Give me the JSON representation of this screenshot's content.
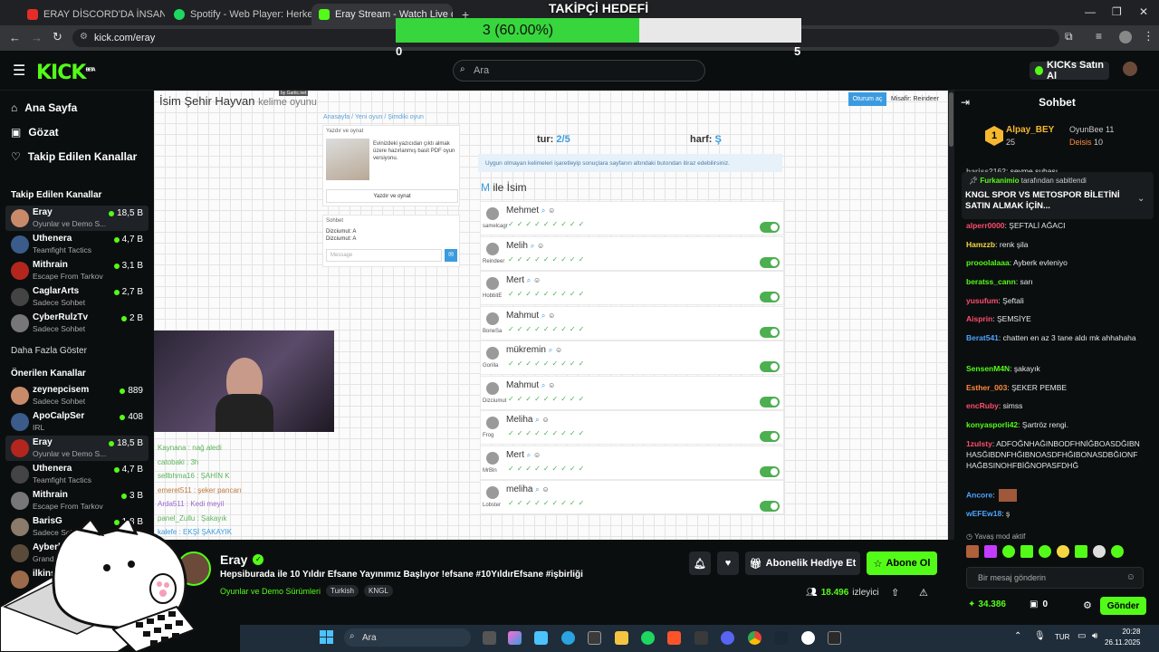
{
  "browser": {
    "tabs": [
      {
        "label": "ERAY DİSCORD'DA İNSANLARI..."
      },
      {
        "label": "Spotify - Web Player: Herkes için..."
      },
      {
        "label": "Eray Stream - Watch Live on Kick"
      }
    ],
    "new_tab": "+",
    "url": "kick.com/eray"
  },
  "goal": {
    "title": "TAKİPÇİ HEDEFİ",
    "text": "3 (60.00%)",
    "progress": 0.6,
    "min": "0",
    "max": "5"
  },
  "kick": {
    "logo": "KICK",
    "beta": "BETA",
    "search_placeholder": "Ara",
    "kicks_button": "KICKs Satın Al",
    "accent": "#53fc18"
  },
  "sidebar": {
    "nav": [
      "Ana Sayfa",
      "Gözat",
      "Takip Edilen Kanallar"
    ],
    "followed_title": "Takip Edilen Kanallar",
    "followed": [
      {
        "name": "Eray",
        "game": "Oyunlar ve Demo S...",
        "viewers": "18,5 B"
      },
      {
        "name": "Uthenera",
        "game": "Teamfight Tactics",
        "viewers": "4,7 B"
      },
      {
        "name": "Mithrain",
        "game": "Escape From Tarkov",
        "viewers": "3,1 B"
      },
      {
        "name": "CaglarArts",
        "game": "Sadece Sohbet",
        "viewers": "2,7 B"
      },
      {
        "name": "CyberRulzTv",
        "game": "Sadece Sohbet",
        "viewers": "2 B"
      }
    ],
    "show_more": "Daha Fazla Göster",
    "recommended_title": "Önerilen Kanallar",
    "recommended": [
      {
        "name": "zeynepcisem",
        "game": "Sadece Sohbet",
        "viewers": "889"
      },
      {
        "name": "ApoCalpSer",
        "game": "IRL",
        "viewers": "408"
      },
      {
        "name": "Eray",
        "game": "Oyunlar ve Demo S...",
        "viewers": "18,5 B"
      },
      {
        "name": "Uthenera",
        "game": "Teamfight Tactics",
        "viewers": "4,7 B"
      },
      {
        "name": "Mithrain",
        "game": "Escape From Tarkov",
        "viewers": "3 B"
      },
      {
        "name": "BarisG",
        "game": "Sadece Sohbet",
        "viewers": "1,8 B"
      },
      {
        "name": "Ayberk",
        "game": "Grand T...",
        "viewers": ""
      },
      {
        "name": "ilkins",
        "game": "",
        "viewers": ""
      }
    ]
  },
  "game": {
    "title": "İsim Şehir Hayvan",
    "subtitle": "kelime oyunu",
    "by": "by Gartic.net",
    "breadcrumb": "Anasayfa  /  Yeni oyun  /  Şimdiki oyun",
    "room_btn": "Oturum aç",
    "guest": "Misafir: Reindeer",
    "print_title": "Yazdır ve oynat",
    "print_desc": "Evinizdeki yazıcıdan çıktı almak üzere hazırlanmış basit PDF oyun versiyonu.",
    "print_btn": "Yazdır ve oynat",
    "chat_title": "Sohbet",
    "chat_lines": [
      "Dizciumut: A",
      "Dizciumut: A"
    ],
    "msg_placeholder": "Message",
    "round_label": "tur:",
    "round_value": "2/5",
    "letter_label": "harf:",
    "letter_value": "Ş",
    "notice": "Uygun olmayan kelimeleri işaretleyip sonuçlara sayfanın altındaki butondan itiraz edebilirsiniz.",
    "category_letter": "M",
    "category": "ile İsim",
    "words": [
      {
        "word": "Mehmet",
        "player": "samelcagr"
      },
      {
        "word": "Melih",
        "player": "Reindeer"
      },
      {
        "word": "Mert",
        "player": "HobbitE"
      },
      {
        "word": "Mahmut",
        "player": "BoneSa"
      },
      {
        "word": "mükremin",
        "player": "Gorilla"
      },
      {
        "word": "Mahmut",
        "player": "Dizciumut"
      },
      {
        "word": "Meliha",
        "player": "Frog"
      },
      {
        "word": "Mert",
        "player": "MrBln"
      },
      {
        "word": "meliha",
        "player": "Lobster"
      }
    ],
    "checks": "✓✓✓✓✓✓✓✓✓",
    "overlay_chat": [
      "Kaynana : nağ aledi",
      "catobaki : 3h",
      "sellbhma16 : ŞAHİN K",
      "emeret511 : şeker pancarı",
      "Arda511 : Kedi meyil",
      "panel_Zullu : Şakayık",
      "kalefe : EKŞİ ŞAKAYIK"
    ]
  },
  "stream_info": {
    "name": "Eray",
    "title": "Hepsiburada ile 10 Yıldır Efsane Yayınımız Başlıyor !efsane #10YıldırEfsane #işbirliği",
    "category": "Oyunlar ve Demo Sürümleri",
    "tags": [
      "Turkish",
      "KNGL"
    ],
    "gift_btn": "Abonelik Hediye Et",
    "sub_btn": "Abone Ol",
    "viewers": "18.496",
    "viewers_label": "izleyici"
  },
  "chat": {
    "title": "Sohbet",
    "top": [
      {
        "name": "Alpay_BEY",
        "count": "25"
      },
      {
        "name": "OyunBee",
        "count": "11"
      },
      {
        "name": "Deisis",
        "count": "10"
      }
    ],
    "rank": "1",
    "pinned_by": "Furkanimio",
    "pinned_by_suffix": "tarafından sabitlendi",
    "pinned_text": "KNGL SPOR VS METOSPOR BİLETİNİ SATIN ALMAK İÇİN...",
    "messages": [
      {
        "user": "hariss2162",
        "text": "sevme suhası",
        "color": "#9b9b9b"
      },
      {
        "user": "alperr0000",
        "text": "ŞEFTALİ AĞACI",
        "color": "#ff4d6d"
      },
      {
        "user": "Hamzzb",
        "text": "renk şila",
        "color": "#f5d742"
      },
      {
        "user": "prooolalaaa",
        "text": "Ayberk evleniyo",
        "color": "#53fc18"
      },
      {
        "user": "beratss_cann",
        "text": "sarı",
        "color": "#53fc18"
      },
      {
        "user": "yusufum",
        "text": "Şeftali",
        "color": "#ff4d6d"
      },
      {
        "user": "Aisprin",
        "text": "ŞEMSİYE",
        "color": "#ff4d6d"
      },
      {
        "user": "Berat541",
        "text": "chatten en az 3 tane aldı mk ahhahaha",
        "color": "#4da3ff"
      },
      {
        "user": "SensenM4N",
        "text": "şakayık",
        "color": "#53fc18"
      },
      {
        "user": "Esther_003",
        "text": "ŞEKER PEMBE",
        "color": "#ff8a3d"
      },
      {
        "user": "encRuby",
        "text": "simss",
        "color": "#ff4d6d"
      },
      {
        "user": "konyasporli42",
        "text": "Şartröz rengi.",
        "color": "#53fc18"
      },
      {
        "user": "1zulsty",
        "text": "ADFOĞNHAĞINBODFHNİĞBOASDĞIBNHASĞIBDNFHĞIBNOASDFHĞIBONASDBĞIONFHAĞBSINOHFBİĞNOPASFDHĞ",
        "color": "#ff4d6d"
      },
      {
        "user": "Ancore",
        "text": "",
        "color": "#4da3ff"
      },
      {
        "user": "wEFEw18",
        "text": "ş",
        "color": "#4da3ff"
      }
    ],
    "slow_mode": "Yavaş mod aktif",
    "input_placeholder": "Bir mesaj gönderin",
    "points": "34.386",
    "other_count": "0",
    "send_btn": "Gönder"
  },
  "taskbar": {
    "search": "Ara",
    "lang": "TUR",
    "time": "20:28",
    "date": "26.11.2025"
  }
}
